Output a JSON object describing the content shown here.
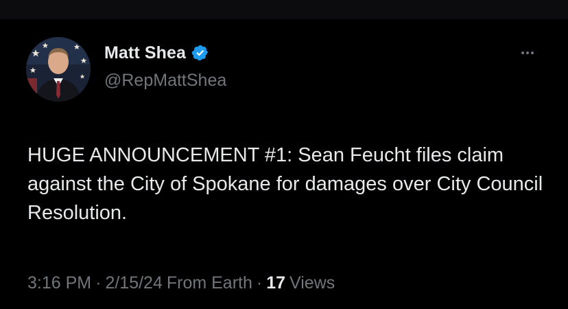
{
  "author": {
    "display_name": "Matt Shea",
    "handle": "@RepMattShea",
    "verified": true,
    "verified_color": "#1d9bf0",
    "avatar_icon": "profile-photo"
  },
  "tweet": {
    "text": "HUGE ANNOUNCEMENT #1: Sean Feucht files claim against the City of Spokane for damages over City Council Resolution."
  },
  "meta": {
    "time": "3:16 PM",
    "date": "2/15/24",
    "source": "From Earth",
    "separator": "·",
    "views_count": "17",
    "views_label": "Views"
  },
  "more_icon": "more-horizontal-icon",
  "colors": {
    "background": "#000000",
    "primary_text": "#e7e9ea",
    "secondary_text": "#71767b"
  }
}
